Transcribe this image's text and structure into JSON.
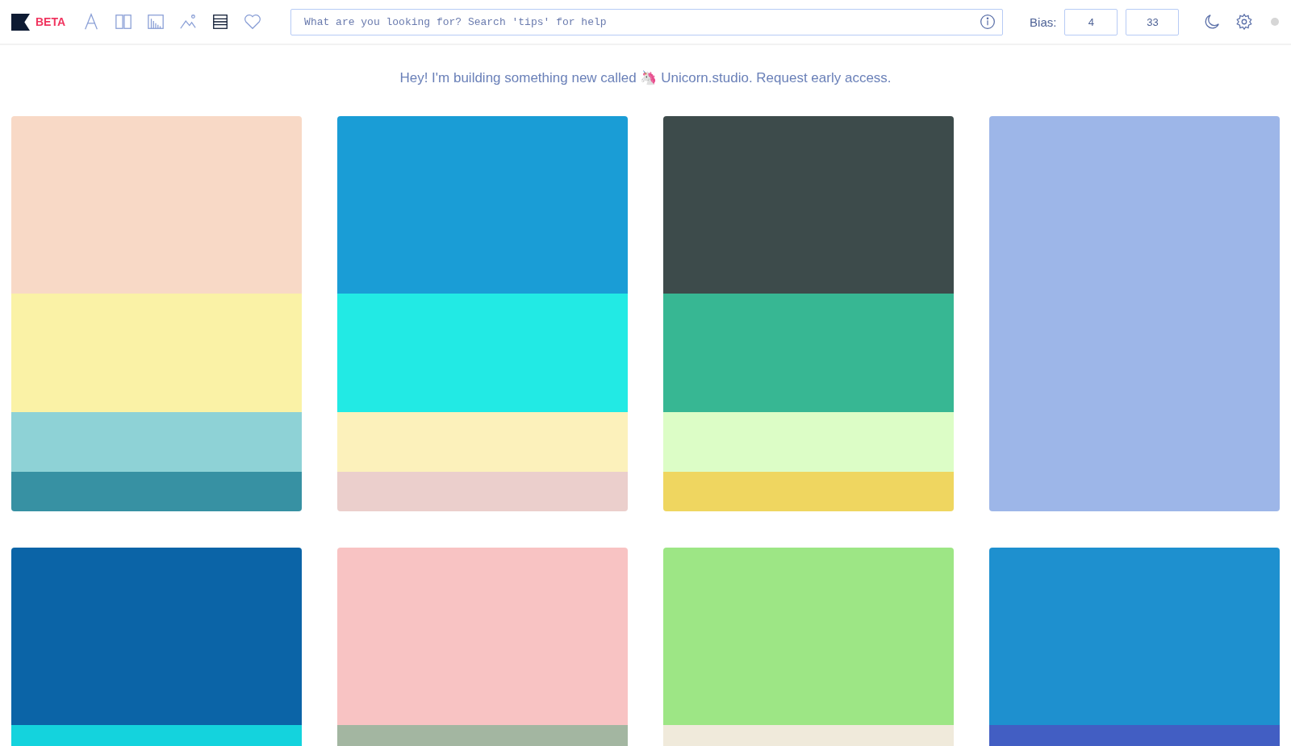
{
  "header": {
    "logo_badge": "BETA",
    "nav": [
      {
        "kind": "font",
        "selected": false
      },
      {
        "kind": "columns",
        "selected": false
      },
      {
        "kind": "chart",
        "selected": false
      },
      {
        "kind": "image",
        "selected": false
      },
      {
        "kind": "list",
        "selected": true
      },
      {
        "kind": "heart",
        "selected": false
      }
    ],
    "search": {
      "placeholder": "What are you looking for? Search 'tips' for help"
    },
    "bias": {
      "label": "Bias:",
      "values": [
        "4",
        "33"
      ]
    }
  },
  "banner": "Hey! I'm building something new called 🦄 Unicorn.studio. Request early access.",
  "palettes": [
    {
      "swatches": [
        {
          "color": "#f8d9c6"
        },
        {
          "color": "#faf2a6"
        },
        {
          "color": "#8ed2d6"
        },
        {
          "color": "#3791a3"
        }
      ]
    },
    {
      "swatches": [
        {
          "color": "#1a9dd6"
        },
        {
          "color": "#22eae4"
        },
        {
          "color": "#fcf1bb"
        },
        {
          "color": "#ebcfcc"
        }
      ]
    },
    {
      "swatches": [
        {
          "color": "#3d4b4b"
        },
        {
          "color": "#37b793"
        },
        {
          "color": "#dcfdc6"
        },
        {
          "color": "#efd660"
        }
      ]
    },
    {
      "swatches": [
        {
          "color": "#9db6e8"
        }
      ]
    },
    {
      "swatches": [
        {
          "color": "#0b64a7"
        },
        {
          "color": "#14d3dd"
        }
      ]
    },
    {
      "swatches": [
        {
          "color": "#f8c3c3"
        },
        {
          "color": "#a3b6a1"
        }
      ]
    },
    {
      "swatches": [
        {
          "color": "#9de685"
        },
        {
          "color": "#f0eadb"
        }
      ]
    },
    {
      "swatches": [
        {
          "color": "#1e90cf"
        },
        {
          "color": "#425ec3"
        }
      ]
    }
  ]
}
